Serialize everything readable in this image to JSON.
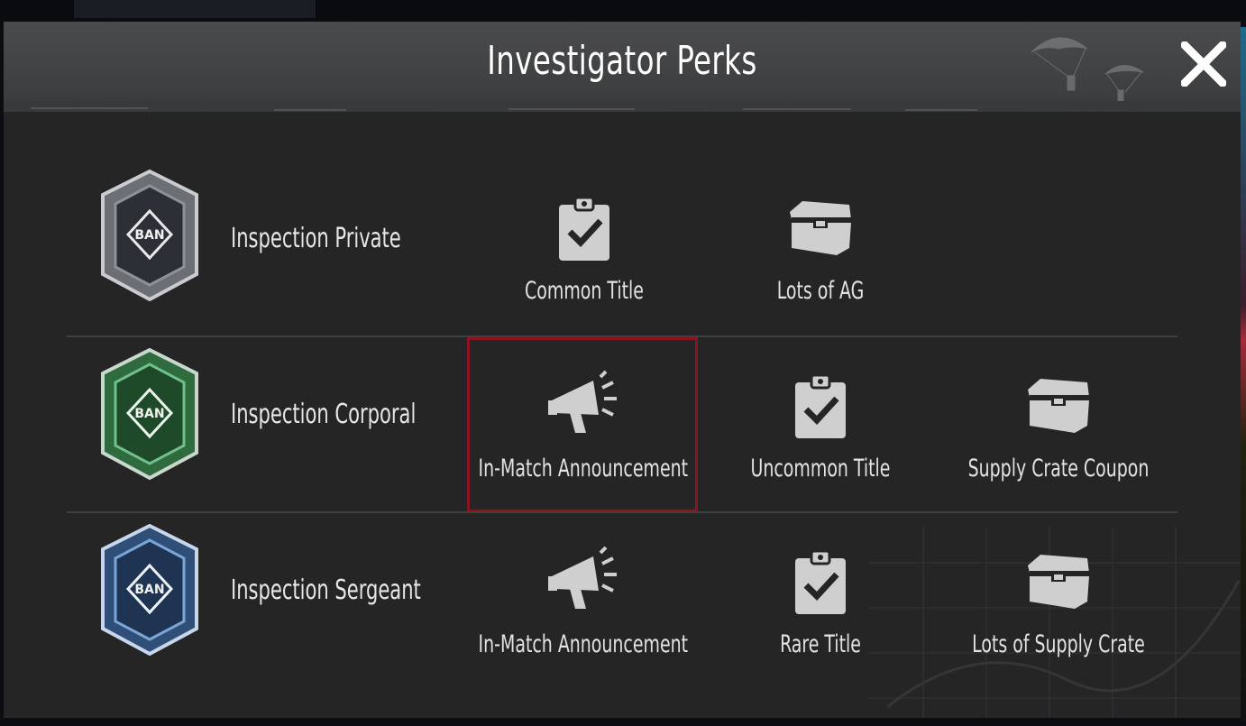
{
  "dialog": {
    "title": "Investigator Perks",
    "close_icon": "close-x-icon"
  },
  "accent_colors": {
    "selected_outline": "#8a1520",
    "text": "#e6e6e6"
  },
  "ranks": [
    {
      "name": "Inspection Private",
      "badge_text": "BAN",
      "badge_color": "#9a9ca0",
      "perks": [
        {
          "label": "Common Title",
          "icon": "clipboard-check-icon"
        },
        {
          "label": "Lots of AG",
          "icon": "chest-icon"
        }
      ]
    },
    {
      "name": "Inspection Corporal",
      "badge_text": "BAN",
      "badge_color": "#3fa05a",
      "perks": [
        {
          "label": "In-Match Announcement",
          "icon": "megaphone-icon",
          "selected": true
        },
        {
          "label": "Uncommon Title",
          "icon": "clipboard-check-icon"
        },
        {
          "label": "Supply Crate Coupon",
          "icon": "chest-icon"
        }
      ]
    },
    {
      "name": "Inspection Sergeant",
      "badge_text": "BAN",
      "badge_color": "#4a78b0",
      "perks": [
        {
          "label": "In-Match Announcement",
          "icon": "megaphone-icon"
        },
        {
          "label": "Rare Title",
          "icon": "clipboard-check-icon"
        },
        {
          "label": "Lots of Supply Crate",
          "icon": "chest-icon"
        }
      ]
    }
  ]
}
